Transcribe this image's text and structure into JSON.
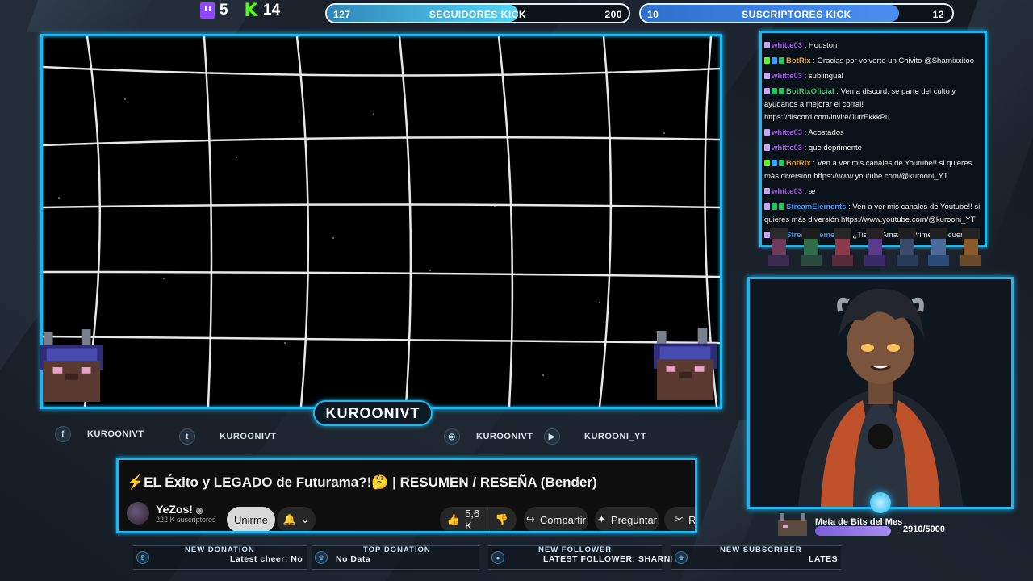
{
  "top": {
    "twitch_count": "5",
    "kick_count": "14",
    "followers_goal": {
      "current": "127",
      "label": "SEGUIDORES KICK",
      "target": "200",
      "progress": 0.635
    },
    "subs_goal": {
      "current": "10",
      "label": "SUSCRIPTORES KICK",
      "target": "12",
      "progress": 0.83
    }
  },
  "brand": {
    "name": "KUROONIVT"
  },
  "socials": [
    {
      "icon": "facebook-icon",
      "glyph": "f",
      "handle": "KUROONIVT"
    },
    {
      "icon": "twitter-icon",
      "glyph": "t",
      "handle": "KUROONIVT"
    },
    {
      "icon": "instagram-icon",
      "glyph": "◎",
      "handle": "KUROONIVT"
    },
    {
      "icon": "youtube-icon",
      "glyph": "▶",
      "handle": "KUROONI_YT"
    }
  ],
  "video": {
    "title": "⚡EL Éxito y LEGADO de Futurama?!🤔 | RESUMEN / RESEÑA (Bender)",
    "channel": "YeZos!",
    "subscribers": "222 K suscriptores",
    "subscribe_label": "Unirme",
    "likes": "5,6 K",
    "share_label": "Compartir",
    "ask_label": "Preguntar",
    "clip_label": "Re"
  },
  "chat": {
    "messages": [
      {
        "user": "whitte03",
        "color": "#9b59d8",
        "badges": [
          "#c9a6ff"
        ],
        "text": ": Houston"
      },
      {
        "user": "BotRix",
        "color": "#e8a33a",
        "badges": [
          "#53fc18",
          "#3ba0ff",
          "#22c55e"
        ],
        "text": ": Gracias por volverte un Chivito @Sharnixxitoo"
      },
      {
        "user": "whitte03",
        "color": "#9b59d8",
        "badges": [
          "#c9a6ff"
        ],
        "text": ": sublingual"
      },
      {
        "user": "BotRixOficial",
        "color": "#3ec26b",
        "badges": [
          "#c9a6ff",
          "#22c55e",
          "#22c55e"
        ],
        "text": ": Ven a discord, se parte del culto y ayudanos a mejorar el corral! https://discord.com/invite/JutrEkkkPu"
      },
      {
        "user": "whitte03",
        "color": "#9b59d8",
        "badges": [
          "#c9a6ff"
        ],
        "text": ": Acostados"
      },
      {
        "user": "whitte03",
        "color": "#9b59d8",
        "badges": [
          "#c9a6ff"
        ],
        "text": ": que deprimente"
      },
      {
        "user": "BotRix",
        "color": "#e8a33a",
        "badges": [
          "#53fc18",
          "#3ba0ff",
          "#22c55e"
        ],
        "text": ": Ven a ver mis canales de Youtube!! si quieres más diversión https://www.youtube.com/@kurooni_YT"
      },
      {
        "user": "whitte03",
        "color": "#9b59d8",
        "badges": [
          "#c9a6ff"
        ],
        "text": ": æ"
      },
      {
        "user": "StreamElements",
        "color": "#3b8ff0",
        "badges": [
          "#c9a6ff",
          "#22c55e",
          "#22c55e"
        ],
        "text": ": Ven a ver mis canales de Youtube!! si quieres más diversión https://www.youtube.com/@kurooni_YT"
      },
      {
        "user": "StreamElements",
        "color": "#3b8ff0",
        "badges": [
          "#c9a6ff",
          "#22c55e",
          "#22c55e"
        ],
        "text": ": ¿Tienes Amazon Prime? Recuerda que puedes"
      }
    ]
  },
  "bits": {
    "label": "Meta de Bits del Mes",
    "value": "2910/5000",
    "progress": 0.582
  },
  "bottom": [
    {
      "label": "NEW DONATION",
      "value": "Latest cheer: No",
      "icon": "donation-icon",
      "glyph": "$"
    },
    {
      "label": "TOP DONATION",
      "value": "No Data",
      "icon": "trophy-icon",
      "glyph": "♛"
    },
    {
      "label": "NEW FOLLOWER",
      "value": "LATEST FOLLOWER: SHARNI",
      "icon": "follower-icon",
      "glyph": "●"
    },
    {
      "label": "NEW SUBSCRIBER",
      "value": "LATES",
      "icon": "crown-icon",
      "glyph": "♚"
    }
  ]
}
